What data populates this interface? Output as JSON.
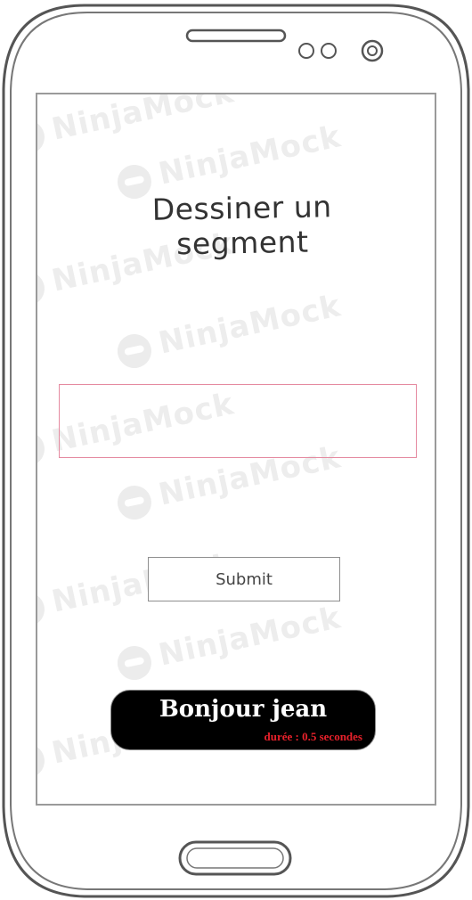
{
  "screen": {
    "title": "Dessiner un segment",
    "input_value": "",
    "submit_label": "Submit"
  },
  "toast": {
    "message": "Bonjour jean",
    "duration_text": "durée : 0.5 secondes",
    "duration_color": "#e8212b"
  },
  "watermark": {
    "brand": "NinjaMock"
  },
  "colors": {
    "input_border": "#e58aa0",
    "toast_background": "#000000"
  }
}
